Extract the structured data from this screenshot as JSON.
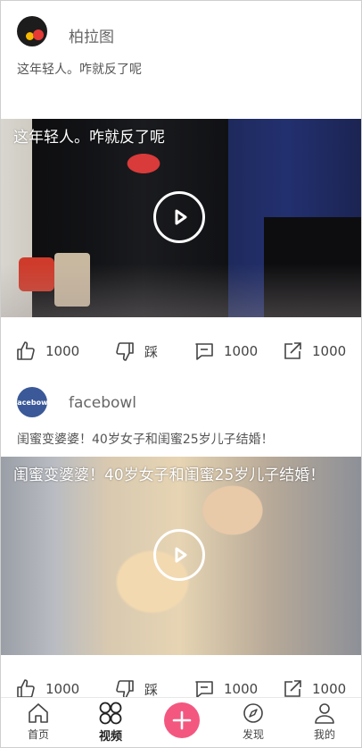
{
  "posts": [
    {
      "author": "柏拉图",
      "caption": "这年轻人。咋就反了呢",
      "video_title": "这年轻人。咋就反了呢",
      "likes": "1000",
      "dislike_label": "踩",
      "comments": "1000",
      "shares": "1000"
    },
    {
      "author": "facebowl",
      "avatar_text": "facebowl",
      "caption": "闺蜜变婆婆！40岁女子和闺蜜25岁儿子结婚！",
      "video_title": "闺蜜变婆婆！40岁女子和闺蜜25岁儿子结婚！",
      "likes": "1000",
      "dislike_label": "踩",
      "comments": "1000",
      "shares": "1000"
    }
  ],
  "tabbar": {
    "home": "首页",
    "video": "视频",
    "discover": "发现",
    "mine": "我的"
  },
  "colors": {
    "accent": "#f3577f"
  }
}
